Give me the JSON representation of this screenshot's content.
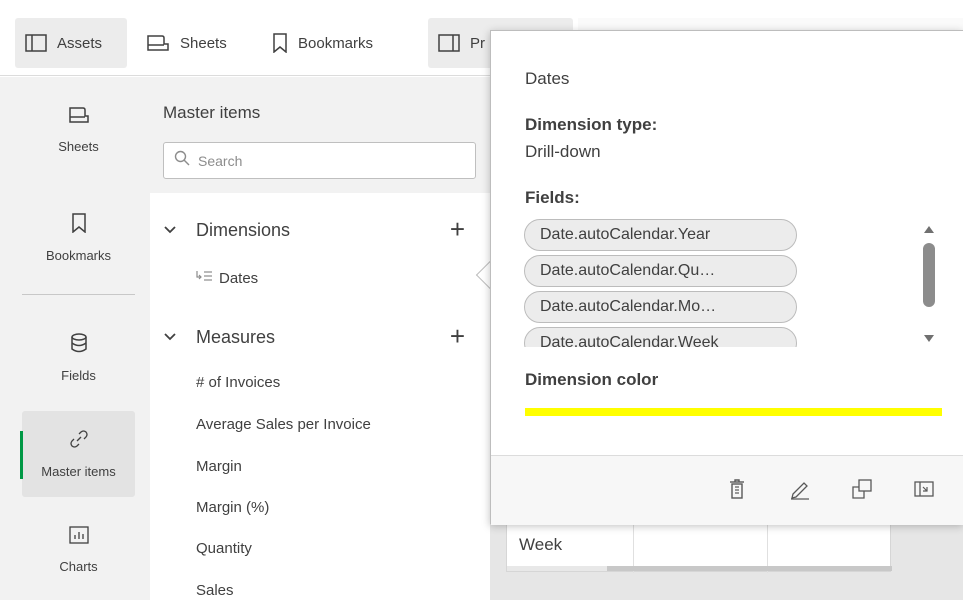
{
  "topbar": {
    "tabs": [
      {
        "label": "Assets",
        "icon": "panel-icon",
        "active": true
      },
      {
        "label": "Sheets",
        "icon": "sheet-icon",
        "active": false
      },
      {
        "label": "Bookmarks",
        "icon": "bookmark-icon",
        "active": false
      },
      {
        "label": "Pr",
        "icon": "panel-right-icon",
        "active": false
      }
    ]
  },
  "rail": {
    "items": [
      {
        "label": "Sheets",
        "icon": "sheet-icon"
      },
      {
        "label": "Bookmarks",
        "icon": "bookmark-icon"
      },
      {
        "label": "Fields",
        "icon": "database-icon"
      },
      {
        "label": "Master items",
        "icon": "link-icon",
        "active": true
      },
      {
        "label": "Charts",
        "icon": "chart-icon"
      }
    ],
    "accent": "#009845"
  },
  "panel": {
    "title": "Master items",
    "search_placeholder": "Search",
    "dimensions": {
      "label": "Dimensions",
      "items": [
        "Dates"
      ]
    },
    "measures": {
      "label": "Measures",
      "items": [
        "# of Invoices",
        "Average Sales per Invoice",
        "Margin",
        "Margin (%)",
        "Quantity",
        "Sales"
      ]
    }
  },
  "popover": {
    "title": "Dates",
    "dimension_type_label": "Dimension type:",
    "dimension_type_value": "Drill-down",
    "fields_label": "Fields:",
    "fields": [
      "Date.autoCalendar.Year",
      "Date.autoCalendar.Qu…",
      "Date.autoCalendar.Mo…",
      "Date.autoCalendar.Week"
    ],
    "color_label": "Dimension color",
    "color_value": "#ffff00",
    "footer_icons": [
      "delete-icon",
      "edit-icon",
      "duplicate-icon",
      "expand-icon"
    ]
  },
  "background": {
    "week_label": "Week"
  }
}
